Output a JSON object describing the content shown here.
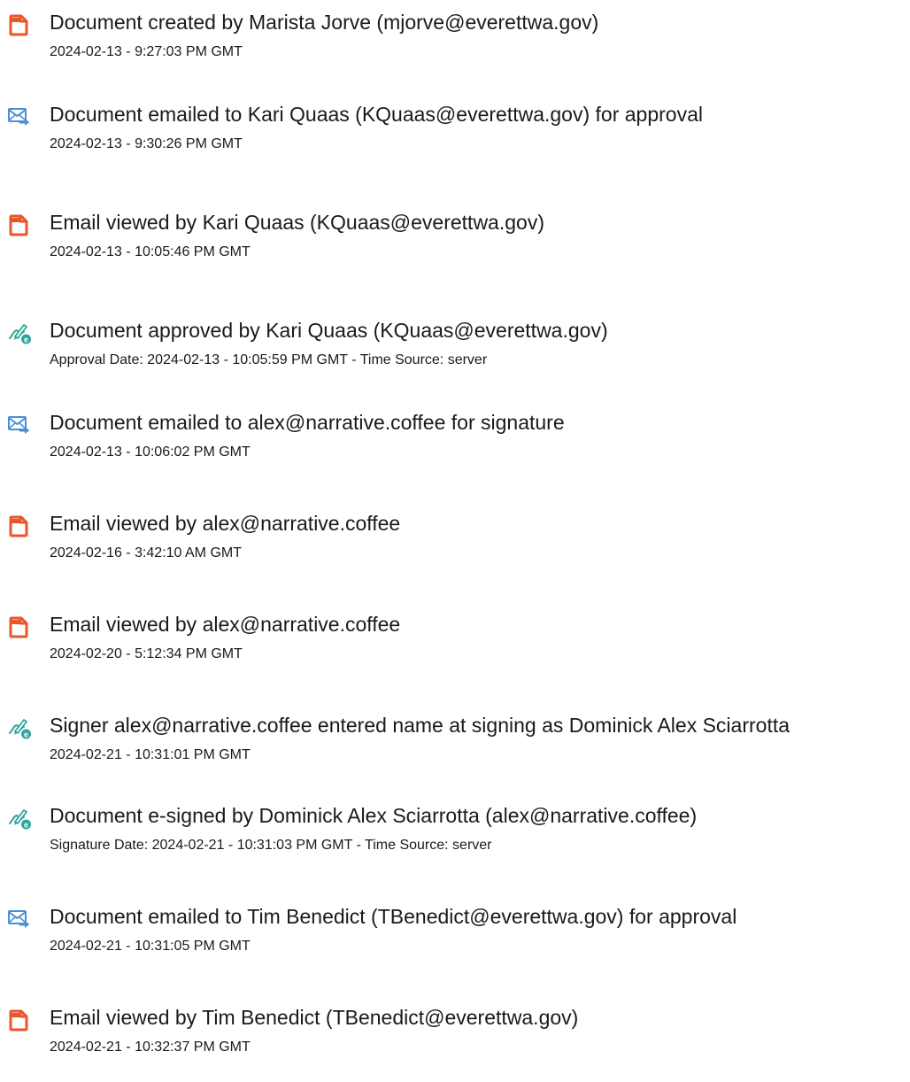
{
  "colors": {
    "doc_icon": "#e8562a",
    "email_icon": "#4a8fd6",
    "sign_icon": "#2fa59b",
    "text": "#1a1a1a"
  },
  "events": [
    {
      "icon": "document-icon",
      "title": "Document created by Marista Jorve (mjorve@everettwa.gov)",
      "detail": "2024-02-13 - 9:27:03 PM GMT"
    },
    {
      "icon": "email-sent-icon",
      "title": "Document emailed to Kari Quaas (KQuaas@everettwa.gov) for approval",
      "detail": "2024-02-13 - 9:30:26 PM GMT"
    },
    {
      "icon": "document-icon",
      "title": "Email viewed by Kari Quaas (KQuaas@everettwa.gov)",
      "detail": "2024-02-13 - 10:05:46 PM GMT"
    },
    {
      "icon": "e-sign-icon",
      "title": "Document approved by Kari Quaas (KQuaas@everettwa.gov)",
      "detail": "Approval Date: 2024-02-13 - 10:05:59 PM GMT - Time Source: server"
    },
    {
      "icon": "email-sent-icon",
      "title": "Document emailed to alex@narrative.coffee for signature",
      "detail": "2024-02-13 - 10:06:02 PM GMT"
    },
    {
      "icon": "document-icon",
      "title": "Email viewed by alex@narrative.coffee",
      "detail": "2024-02-16 - 3:42:10 AM GMT"
    },
    {
      "icon": "document-icon",
      "title": "Email viewed by alex@narrative.coffee",
      "detail": "2024-02-20 - 5:12:34 PM GMT"
    },
    {
      "icon": "e-sign-icon",
      "title": "Signer alex@narrative.coffee entered name at signing as Dominick Alex Sciarrotta",
      "detail": "2024-02-21 - 10:31:01 PM GMT"
    },
    {
      "icon": "e-sign-icon",
      "title": "Document e-signed by Dominick Alex Sciarrotta (alex@narrative.coffee)",
      "detail": "Signature Date: 2024-02-21 - 10:31:03 PM GMT - Time Source: server"
    },
    {
      "icon": "email-sent-icon",
      "title": "Document emailed to Tim Benedict (TBenedict@everettwa.gov) for approval",
      "detail": "2024-02-21 - 10:31:05 PM GMT"
    },
    {
      "icon": "document-icon",
      "title": "Email viewed by Tim Benedict (TBenedict@everettwa.gov)",
      "detail": "2024-02-21 - 10:32:37 PM GMT"
    }
  ]
}
